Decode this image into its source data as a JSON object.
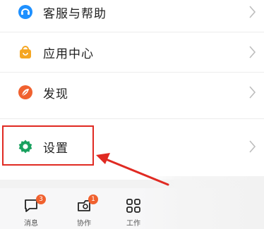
{
  "menu": {
    "items": [
      {
        "id": "support",
        "label": "客服与帮助",
        "icon": "headset-icon",
        "color": "#1e90ff"
      },
      {
        "id": "apps",
        "label": "应用中心",
        "icon": "shopping-bag-icon",
        "color": "#f5a623"
      },
      {
        "id": "discover",
        "label": "发现",
        "icon": "leaf-compass-icon",
        "color": "#f0612f"
      },
      {
        "id": "settings",
        "label": "设置",
        "icon": "gear-icon",
        "color": "#19a15f"
      }
    ]
  },
  "tabbar": {
    "tabs": [
      {
        "id": "messages",
        "label": "消息",
        "icon": "chat-bubble-icon",
        "badge": "3"
      },
      {
        "id": "collab",
        "label": "协作",
        "icon": "collaboration-icon",
        "badge": "1"
      },
      {
        "id": "workbench",
        "label": "工作",
        "icon": "grid-icon",
        "badge": ""
      }
    ]
  },
  "annotation": {
    "color": "#e02a22"
  }
}
